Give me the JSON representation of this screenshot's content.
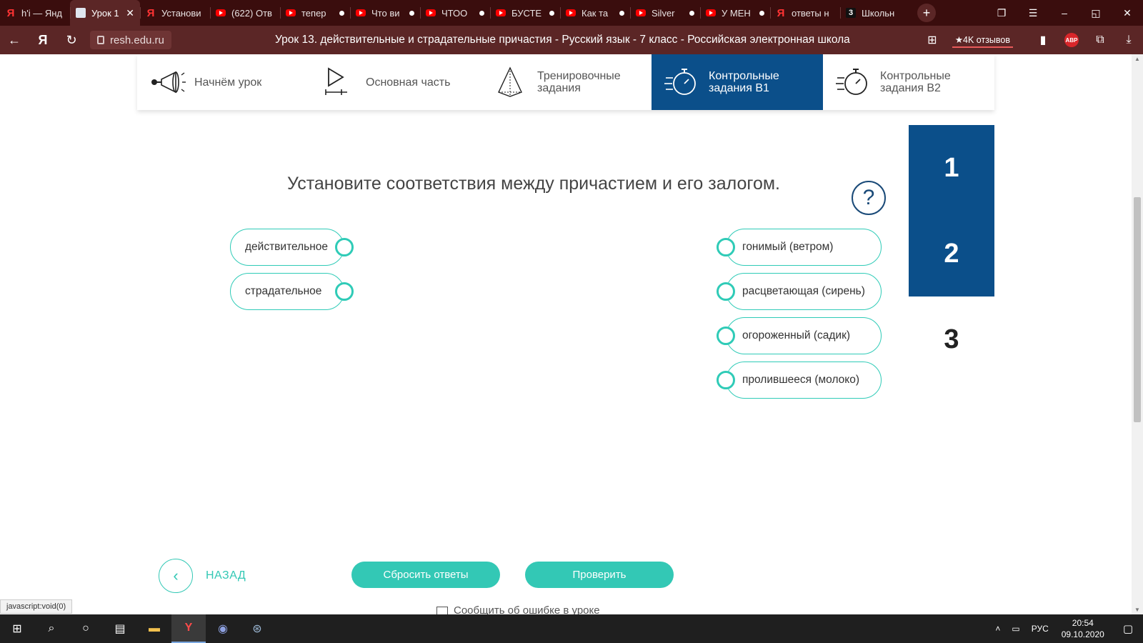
{
  "browser": {
    "tabs": [
      {
        "label": "h'i — Янд",
        "icon": "yandex-icon",
        "active": false,
        "dot": false
      },
      {
        "label": "Урок 1",
        "icon": "document-icon",
        "active": true,
        "dot": false
      },
      {
        "label": "Установи",
        "icon": "yandex-icon",
        "active": false,
        "dot": false
      },
      {
        "label": "(622) Отв",
        "icon": "youtube-icon",
        "active": false,
        "dot": false
      },
      {
        "label": "тепер",
        "icon": "youtube-icon",
        "active": false,
        "dot": true
      },
      {
        "label": "Что ви",
        "icon": "youtube-icon",
        "active": false,
        "dot": true
      },
      {
        "label": "ЧТОО",
        "icon": "youtube-icon",
        "active": false,
        "dot": true
      },
      {
        "label": "БУСТЕ",
        "icon": "youtube-icon",
        "active": false,
        "dot": true
      },
      {
        "label": "Как та",
        "icon": "youtube-icon",
        "active": false,
        "dot": true
      },
      {
        "label": "Silver",
        "icon": "youtube-icon",
        "active": false,
        "dot": true
      },
      {
        "label": "У МЕН",
        "icon": "youtube-icon",
        "active": false,
        "dot": true
      },
      {
        "label": "ответы н",
        "icon": "yandex-icon",
        "active": false,
        "dot": false
      },
      {
        "label": "Школьн",
        "icon": "znanija-icon",
        "active": false,
        "dot": false
      }
    ],
    "favicon_z3": "3",
    "url": "resh.edu.ru",
    "page_title": "Урок 13. действительные и страдательные причастия - Русский язык - 7 класс - Российская электронная школа",
    "reviews_label": "★4K отзывов",
    "abp_label": "ABP",
    "status_url": "javascript:void(0)"
  },
  "lesson_nav": {
    "steps": [
      {
        "label": "Начнём урок",
        "icon": "megaphone-icon",
        "active": false
      },
      {
        "label": "Основная часть",
        "icon": "play-icon",
        "active": false
      },
      {
        "label": "Тренировочные задания",
        "icon": "pyramid-icon",
        "active": false
      },
      {
        "label": "Контрольные задания В1",
        "icon": "stopwatch-icon",
        "active": true
      },
      {
        "label": "Контрольные задания В2",
        "icon": "stopwatch-icon",
        "active": false
      }
    ]
  },
  "task": {
    "question": "Установите соответствия между причастием и его залогом.",
    "help_symbol": "?",
    "left_items": [
      "действительное",
      "страдательное"
    ],
    "right_items": [
      "гонимый (ветром)",
      "расцветающая (сирень)",
      "огороженный (садик)",
      "пролившееся (молоко)"
    ],
    "task_numbers": [
      {
        "n": "1",
        "state": "done"
      },
      {
        "n": "2",
        "state": "done"
      },
      {
        "n": "3",
        "state": "current"
      }
    ],
    "reset_label": "Сбросить ответы",
    "check_label": "Проверить",
    "back_label": "НАЗАД",
    "report_label": "Сообщить об ошибке в уроке"
  },
  "taskbar": {
    "lang": "РУС",
    "time": "20:54",
    "date": "09.10.2020"
  },
  "colors": {
    "accent_teal": "#33c8b5",
    "active_blue": "#0b4f8a",
    "browser_dark": "#3a0d0d",
    "browser_bar": "#5b2626"
  }
}
